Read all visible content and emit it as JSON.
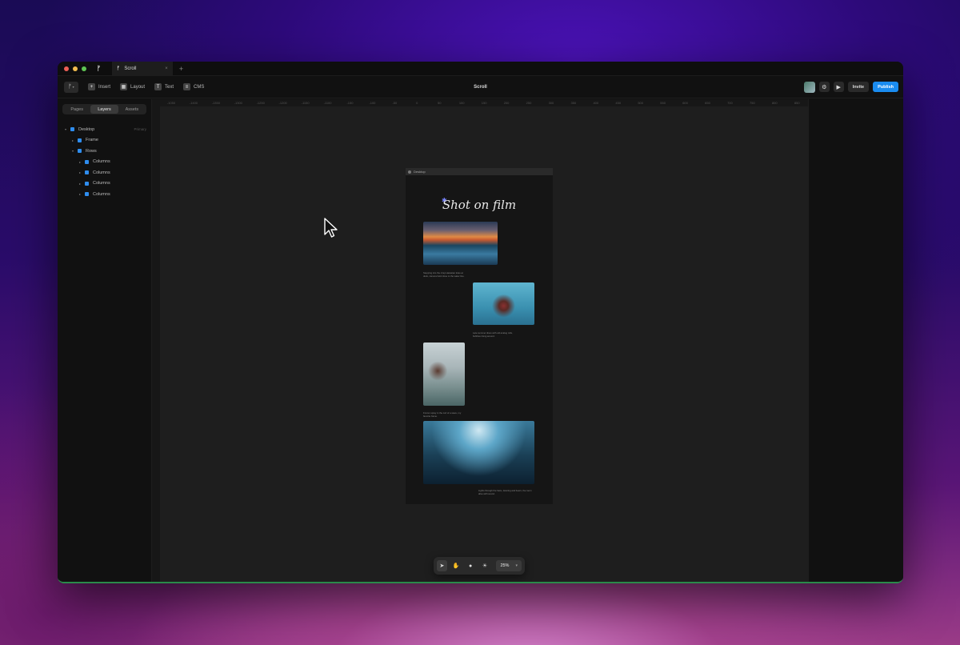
{
  "window": {
    "app_icon": "framer-logo-icon",
    "tab_title": "Scroll",
    "tab_close": "×",
    "new_tab": "+"
  },
  "toolbar": {
    "menu_icon": "ᚠ",
    "items": [
      {
        "label": "Insert",
        "icon": "plus-icon"
      },
      {
        "label": "Layout",
        "icon": "layout-icon"
      },
      {
        "label": "Text",
        "icon": "text-icon"
      },
      {
        "label": "CMS",
        "icon": "database-icon"
      }
    ],
    "project_title": "Scroll",
    "invite_label": "Invite",
    "publish_label": "Publish"
  },
  "sidebar": {
    "tabs": [
      "Pages",
      "Layers",
      "Assets"
    ],
    "active_tab": "Layers",
    "layers": [
      {
        "name": "Desktop",
        "tag": "Primary",
        "depth": 0
      },
      {
        "name": "Frame",
        "tag": "",
        "depth": 1
      },
      {
        "name": "Rows",
        "tag": "",
        "depth": 1
      },
      {
        "name": "Columns",
        "tag": "",
        "depth": 2
      },
      {
        "name": "Columns",
        "tag": "",
        "depth": 2
      },
      {
        "name": "Columns",
        "tag": "",
        "depth": 2
      },
      {
        "name": "Columns",
        "tag": "",
        "depth": 2
      }
    ]
  },
  "ruler": {
    "ticks": [
      "-1050",
      "-1400",
      "-1350",
      "-1300",
      "-1250",
      "-1200",
      "-1150",
      "-1100",
      "-150",
      "-100",
      "-50",
      "0",
      "50",
      "100",
      "150",
      "200",
      "250",
      "300",
      "350",
      "400",
      "450",
      "500",
      "550",
      "600",
      "650",
      "700",
      "750",
      "800",
      "850"
    ]
  },
  "frame": {
    "label": "Desktop",
    "title": "Shot on film",
    "captions": [
      "Stepping into the crisp Hawaiian tides at dusk, camera held close to the water line.",
      "Late summer dives with old analog rolls, bubbles rising around.",
      "Frozen spray in the curl of a wave, my favorite frame.",
      "Lights through the haze, dancing and beers, the room alive with sound."
    ]
  },
  "bottom_bar": {
    "zoom": "25%"
  }
}
